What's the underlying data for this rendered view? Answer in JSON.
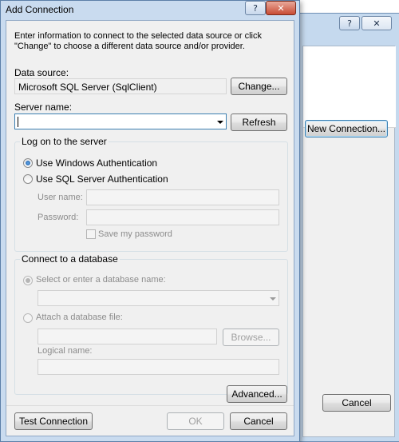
{
  "background_window": {
    "help_glyph": "?",
    "close_glyph": "✕",
    "new_connection_label": "New Connection...",
    "cancel_label": "Cancel"
  },
  "window": {
    "title": "Add Connection",
    "help_glyph": "?",
    "close_glyph": "✕"
  },
  "intro_text": "Enter information to connect to the selected data source or click \"Change\" to choose a different data source and/or provider.",
  "data_source": {
    "label": "Data source:",
    "value": "Microsoft SQL Server (SqlClient)",
    "change_label": "Change..."
  },
  "server": {
    "label": "Server name:",
    "value": "",
    "refresh_label": "Refresh"
  },
  "logon": {
    "group_title": "Log on to the server",
    "windows_auth_label": "Use Windows Authentication",
    "windows_auth_selected": true,
    "sql_auth_label": "Use SQL Server Authentication",
    "sql_auth_selected": false,
    "username_label": "User name:",
    "username_value": "",
    "password_label": "Password:",
    "password_value": "",
    "save_password_label": "Save my password",
    "save_password_checked": false
  },
  "database": {
    "group_title": "Connect to a database",
    "select_label": "Select or enter a database name:",
    "select_selected": true,
    "select_value": "",
    "attach_label": "Attach a database file:",
    "attach_selected": false,
    "attach_value": "",
    "browse_label": "Browse...",
    "logical_name_label": "Logical name:",
    "logical_name_value": ""
  },
  "buttons": {
    "advanced_label": "Advanced...",
    "test_connection_label": "Test Connection",
    "ok_label": "OK",
    "cancel_label": "Cancel"
  },
  "colors": {
    "frame": "#c9dbef",
    "client": "#f0f0f0",
    "focus_border": "#3c7fb1",
    "disabled_text": "#8c8c8c"
  }
}
